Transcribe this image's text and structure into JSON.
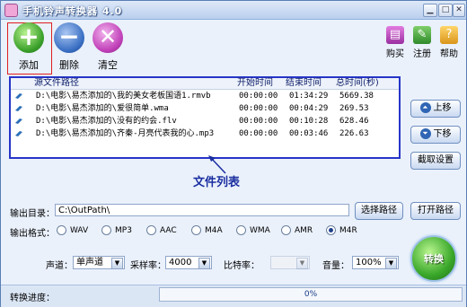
{
  "window": {
    "title": "手机铃声转换器 4.0"
  },
  "toolbar": {
    "add": "添加",
    "delete": "删除",
    "clear": "清空",
    "buy": "购买",
    "register": "注册",
    "help": "帮助"
  },
  "file_list": {
    "headers": {
      "path": "源文件路径",
      "start": "开始时间",
      "end": "结束时间",
      "total": "总时间(秒)"
    },
    "rows": [
      {
        "path": "D:\\电影\\易杰添加的\\我的美女老板国语1.rmvb",
        "start": "00:00:00",
        "end": "01:34:29",
        "total": "5669.38"
      },
      {
        "path": "D:\\电影\\易杰添加的\\爱很简单.wma",
        "start": "00:00:00",
        "end": "00:04:29",
        "total": "269.53"
      },
      {
        "path": "D:\\电影\\易杰添加的\\没有的约会.flv",
        "start": "00:00:00",
        "end": "00:10:28",
        "total": "628.46"
      },
      {
        "path": "D:\\电影\\易杰添加的\\齐秦-月亮代表我的心.mp3",
        "start": "00:00:00",
        "end": "00:03:46",
        "total": "226.63"
      }
    ],
    "annotation": "文件列表"
  },
  "side": {
    "move_up": "上移",
    "move_down": "下移",
    "trim": "截取设置"
  },
  "output": {
    "dir_label": "输出目录：",
    "dir_value": "C:\\OutPath\\",
    "choose_path": "选择路径",
    "open_path": "打开路径",
    "format_label": "输出格式：",
    "formats": [
      "WAV",
      "MP3",
      "AAC",
      "M4A",
      "WMA",
      "AMR",
      "M4R"
    ],
    "selected_format": "M4R"
  },
  "settings": {
    "channel_label": "声道：",
    "channel_value": "单声道",
    "sample_label": "采样率：",
    "sample_value": "4000",
    "bitrate_label": "比特率：",
    "bitrate_value": "",
    "volume_label": "音量：",
    "volume_value": "100%"
  },
  "convert": {
    "label": "转换"
  },
  "status": {
    "progress_label": "转换进度：",
    "progress_text": "0%",
    "progress": 0
  }
}
